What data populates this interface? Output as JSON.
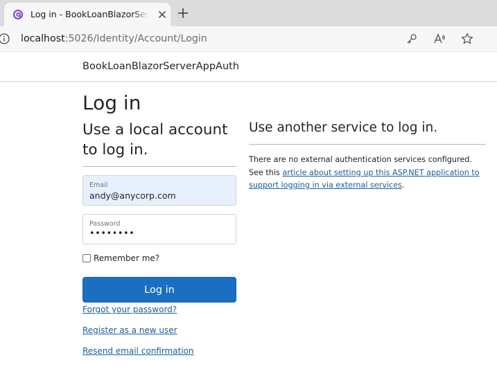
{
  "browser": {
    "tab_title": "Log in - BookLoanBlazorServerApp",
    "url_host": "localhost",
    "url_rest": ":5026/Identity/Account/Login"
  },
  "icons": {
    "favicon": "blazor-favicon",
    "tab_close": "close-icon",
    "new_tab": "plus-icon",
    "site_info": "info-icon",
    "key": "key-icon",
    "read_aloud": "read-aloud-icon",
    "favorite": "star-icon"
  },
  "nav": {
    "brand": "BookLoanBlazorServerAppAuth"
  },
  "login": {
    "title": "Log in",
    "subtitle": "Use a local account to log in.",
    "email_label": "Email",
    "email_value": "andy@anycorp.com",
    "password_label": "Password",
    "password_mask": "••••••••",
    "remember_label": "Remember me?",
    "submit_label": "Log in",
    "forgot_link": "Forgot your password?",
    "register_link": "Register as a new user",
    "resend_link": "Resend email confirmation"
  },
  "external": {
    "title": "Use another service to log in.",
    "text_before": "There are no external authentication services configured. See this ",
    "link_text": "article about setting up this ASP.NET application to support logging in via external services",
    "text_after": "."
  },
  "colors": {
    "primary": "#1b6ec2",
    "link": "#1b5e9b",
    "autofill": "#e8f0fe",
    "favicon": "#7b3fe4"
  }
}
